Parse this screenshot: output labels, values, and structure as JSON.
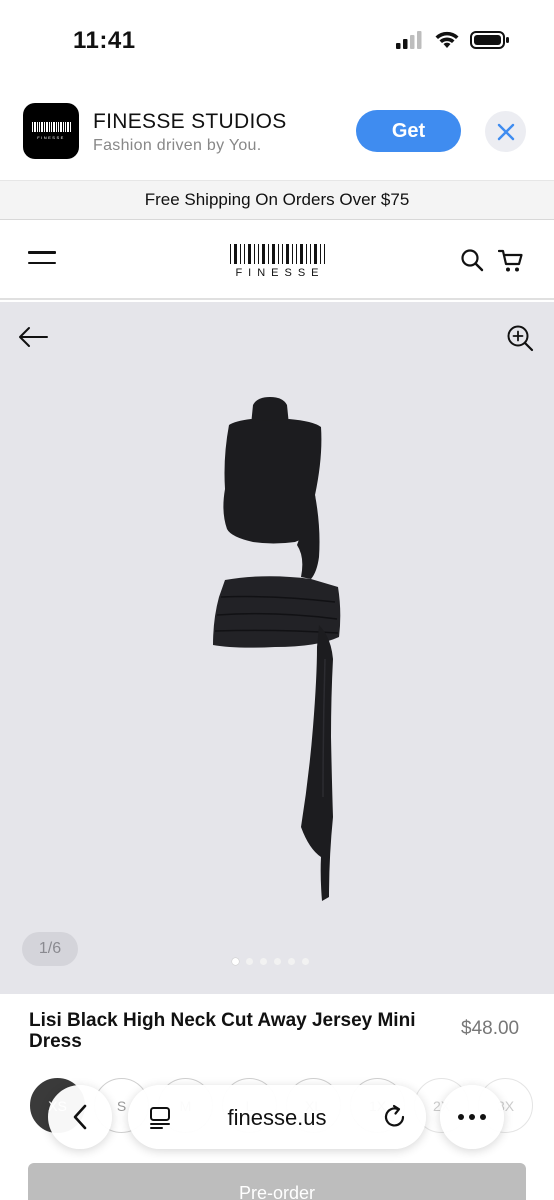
{
  "status_bar": {
    "time": "11:41",
    "icons": [
      "signal-icon",
      "wifi-icon",
      "battery-icon"
    ]
  },
  "app_banner": {
    "app_name": "FINESSE STUDIOS",
    "tagline": "Fashion driven by You.",
    "get_label": "Get",
    "icon_text": "FINESSE"
  },
  "shipping_notice": "Free Shipping On Orders Over $75",
  "site_header": {
    "logo_text": "FINESSE"
  },
  "gallery": {
    "counter": "1/6",
    "total_images": 6,
    "active_index": 0
  },
  "product": {
    "title": "Lisi Black High Neck Cut Away Jersey Mini Dress",
    "price": "$48.00",
    "sizes": [
      {
        "label": "XS",
        "selected": true,
        "available": true
      },
      {
        "label": "S",
        "selected": false,
        "available": true
      },
      {
        "label": "M",
        "selected": false,
        "available": true
      },
      {
        "label": "L",
        "selected": false,
        "available": true
      },
      {
        "label": "XL",
        "selected": false,
        "available": true
      },
      {
        "label": "1X",
        "selected": false,
        "available": true
      },
      {
        "label": "2X",
        "selected": false,
        "available": false
      },
      {
        "label": "3X",
        "selected": false,
        "available": false
      }
    ],
    "cta_label": "Pre-order"
  },
  "browser_bar": {
    "url": "finesse.us"
  },
  "colors": {
    "accent_blue": "#3f8cf0",
    "gallery_bg": "#e5e5ea",
    "dress": "#1c1c1f"
  }
}
